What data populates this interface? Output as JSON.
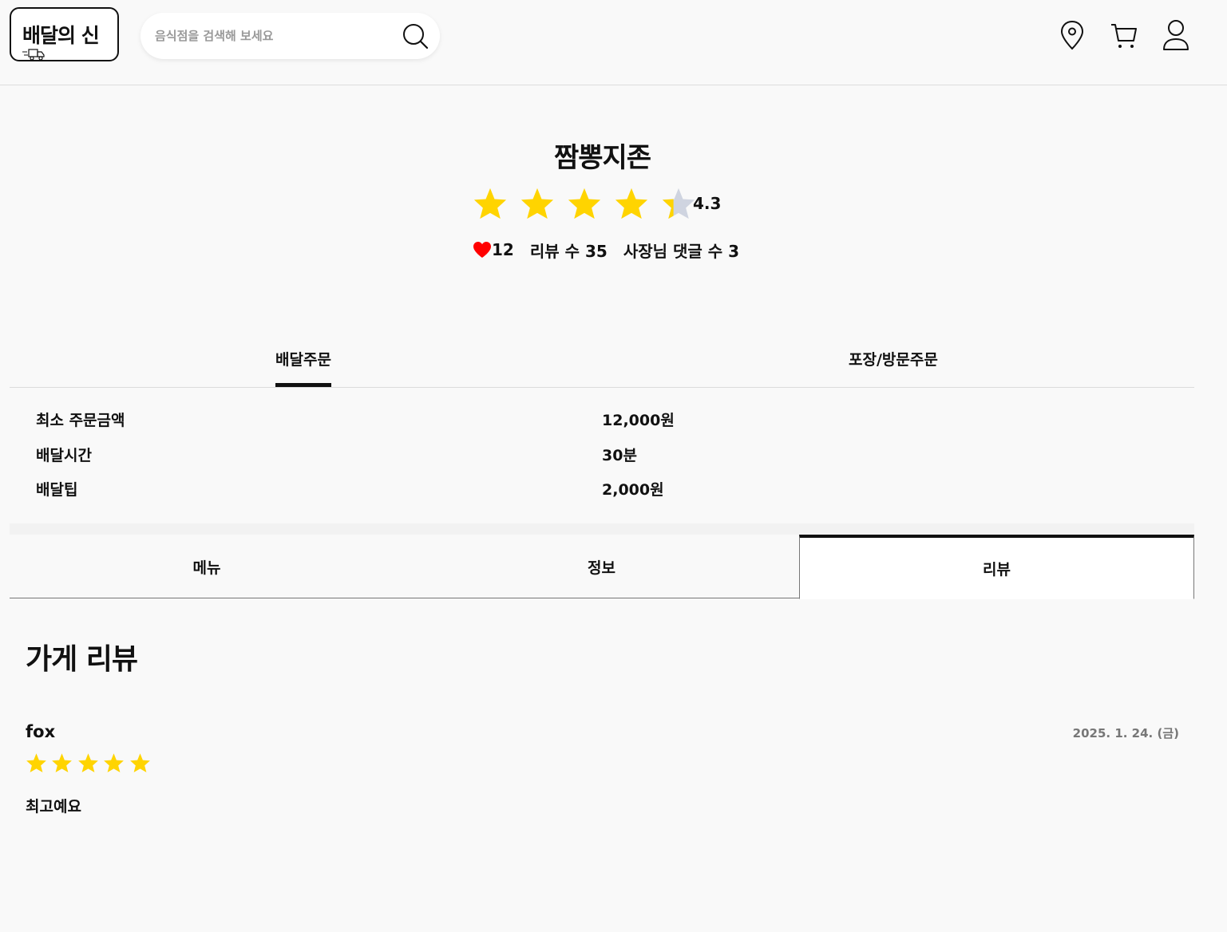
{
  "header": {
    "logo_text": "배달의 신",
    "search": {
      "placeholder": "음식점을 검색해 보세요",
      "value": ""
    },
    "icons": [
      "location-pin-icon",
      "cart-icon",
      "user-icon"
    ]
  },
  "store": {
    "name": "짬뽕지존",
    "rating": "4.3",
    "rating_value": 4.3,
    "rating_max": 5,
    "likes": "12",
    "review_count_label": "리뷰 수 35",
    "owner_reply_label": "사장님 댓글 수 3"
  },
  "order_tabs": [
    {
      "label": "배달주문",
      "active": true
    },
    {
      "label": "포장/방문주문",
      "active": false
    }
  ],
  "delivery_info": [
    {
      "label": "최소 주문금액",
      "value": "12,000원"
    },
    {
      "label": "배달시간",
      "value": "30분"
    },
    {
      "label": "배달팁",
      "value": "2,000원"
    }
  ],
  "main_tabs": [
    {
      "label": "메뉴",
      "active": false
    },
    {
      "label": "정보",
      "active": false
    },
    {
      "label": "리뷰",
      "active": true
    }
  ],
  "reviews": {
    "title": "가게 리뷰",
    "items": [
      {
        "author": "fox",
        "date": "2025. 1. 24. (금)",
        "rating": 5,
        "text": "최고예요"
      }
    ]
  },
  "colors": {
    "star": "#ffd400",
    "star_empty": "#cfd4e0",
    "heart": "#ff0000",
    "text": "#111111",
    "muted": "#777777"
  }
}
